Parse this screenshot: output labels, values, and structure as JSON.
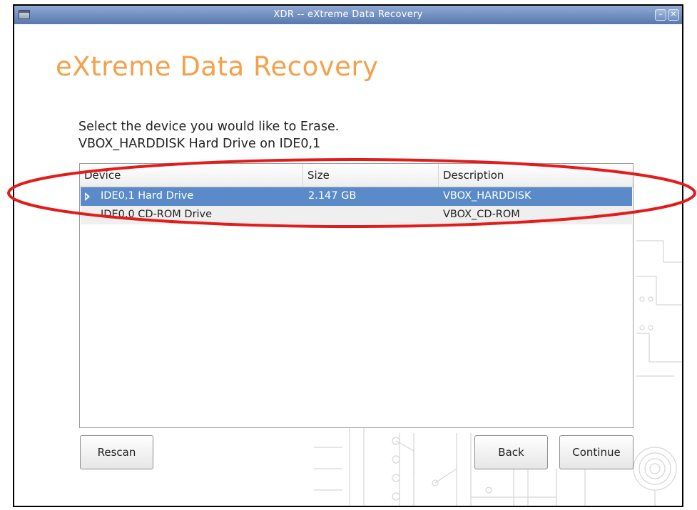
{
  "window": {
    "title": "XDR -- eXtreme Data Recovery",
    "icons": {
      "window_menu": "window-menu-icon",
      "minimize": "minimize-icon",
      "close": "close-icon"
    }
  },
  "app": {
    "title": "eXtreme Data Recovery",
    "accent_color": "#f5a04a"
  },
  "prompt": {
    "line1": "Select the device you would like to Erase.",
    "line2": "VBOX_HARDDISK Hard Drive on IDE0,1"
  },
  "table": {
    "columns": [
      "Device",
      "Size",
      "Description"
    ],
    "rows": [
      {
        "device": "IDE0,1 Hard Drive",
        "size": "2.147 GB",
        "description": "VBOX_HARDDISK",
        "selected": true
      },
      {
        "device": "IDE0,0 CD-ROM Drive",
        "size": "",
        "description": "VBOX_CD-ROM",
        "selected": false
      }
    ],
    "selection_color": "#5a8ac8"
  },
  "buttons": {
    "rescan": "Rescan",
    "back": "Back",
    "continue": "Continue"
  },
  "annotation": {
    "color": "#e31b1b"
  }
}
